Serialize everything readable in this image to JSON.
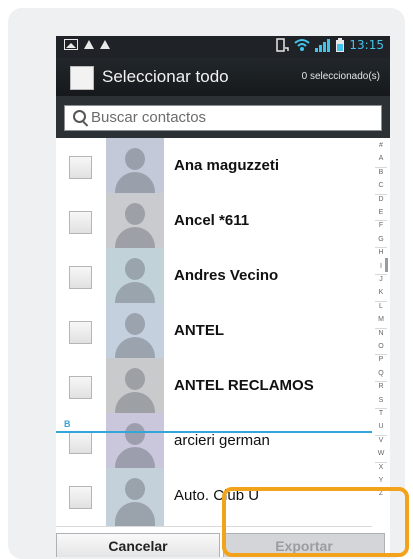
{
  "status_bar": {
    "time": "13:15"
  },
  "action_bar": {
    "select_all_label": "Seleccionar todo",
    "selected_count": "0 seleccionado(s)"
  },
  "search": {
    "placeholder": "Buscar contactos"
  },
  "contacts": [
    {
      "name": "Ana maguzzeti"
    },
    {
      "name": "Ancel *611"
    },
    {
      "name": "Andres Vecino"
    },
    {
      "name": "ANTEL"
    },
    {
      "name": "ANTEL RECLAMOS"
    },
    {
      "name": "arcieri german"
    },
    {
      "name": "Auto. Club U"
    }
  ],
  "section_header": "B",
  "index_letters": [
    "#",
    "A",
    "B",
    "C",
    "D",
    "E",
    "F",
    "G",
    "H",
    "I",
    "J",
    "K",
    "L",
    "M",
    "N",
    "O",
    "P",
    "Q",
    "R",
    "S",
    "T",
    "U",
    "V",
    "W",
    "X",
    "Y",
    "Z"
  ],
  "buttons": {
    "cancel": "Cancelar",
    "export": "Exportar"
  },
  "colors": {
    "accent_blue": "#33a5d9",
    "highlight_orange": "#f2a31b",
    "status_time": "#44c3ea"
  }
}
